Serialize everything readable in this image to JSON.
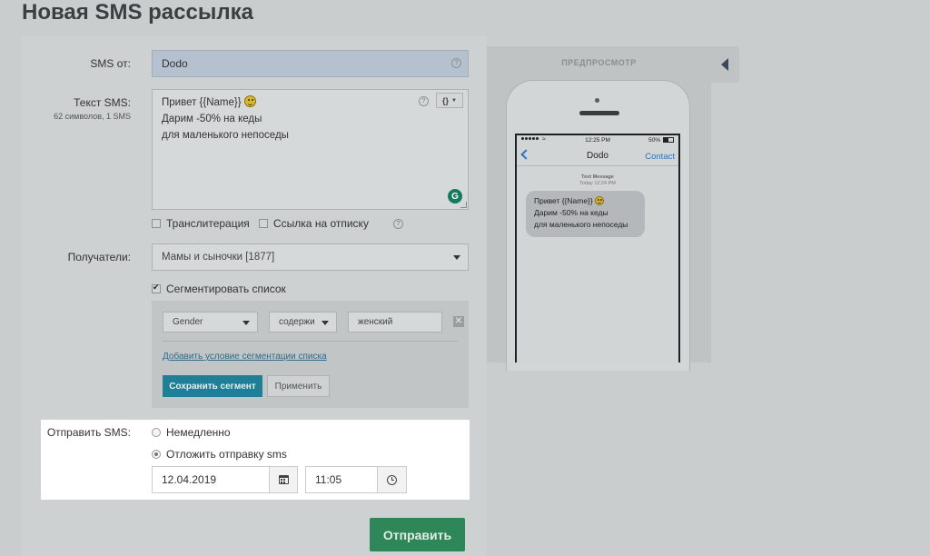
{
  "page": {
    "title": "Новая SMS рассылка"
  },
  "sender": {
    "label": "SMS от:",
    "value": "Dodo"
  },
  "sms_text": {
    "label": "Текст SMS:",
    "counter": "62 символов, 1 SMS",
    "lines": [
      "Привет {{Name}}",
      "Дарим -50% на кеды",
      "для маленького непоседы"
    ],
    "vars_button": "{}"
  },
  "options": {
    "transliteration": {
      "label": "Транслитерация",
      "checked": false
    },
    "unsubscribe_link": {
      "label": "Ссылка на отписку",
      "checked": false
    }
  },
  "recipients": {
    "label": "Получатели:",
    "value": "Мамы и сыночки [1877]"
  },
  "segment": {
    "checkbox_label": "Сегментировать список",
    "checked": true,
    "condition": {
      "field": "Gender",
      "operator": "содержи",
      "value": "женский"
    },
    "add_condition_link": "Добавить условие сегментации списка",
    "save_button": "Сохранить сегмент",
    "apply_button": "Применить"
  },
  "send_time": {
    "label": "Отправить SMS:",
    "immediately_label": "Немедленно",
    "delay_label": "Отложить отправку sms",
    "selected": "delay",
    "date": "12.04.2019",
    "time": "11:05"
  },
  "send_button": "Отправить",
  "preview": {
    "title": "ПРЕДПРОСМОТР",
    "status_time": "12:25 PM",
    "battery": "50%",
    "contact_name": "Dodo",
    "contact_link": "Contact",
    "meta_title": "Text Message",
    "meta_time": "Today 12:24 PM",
    "message_lines": [
      "Привет {{Name}}",
      "Дарим -50% на кеды",
      "для маленького непоседы"
    ]
  }
}
